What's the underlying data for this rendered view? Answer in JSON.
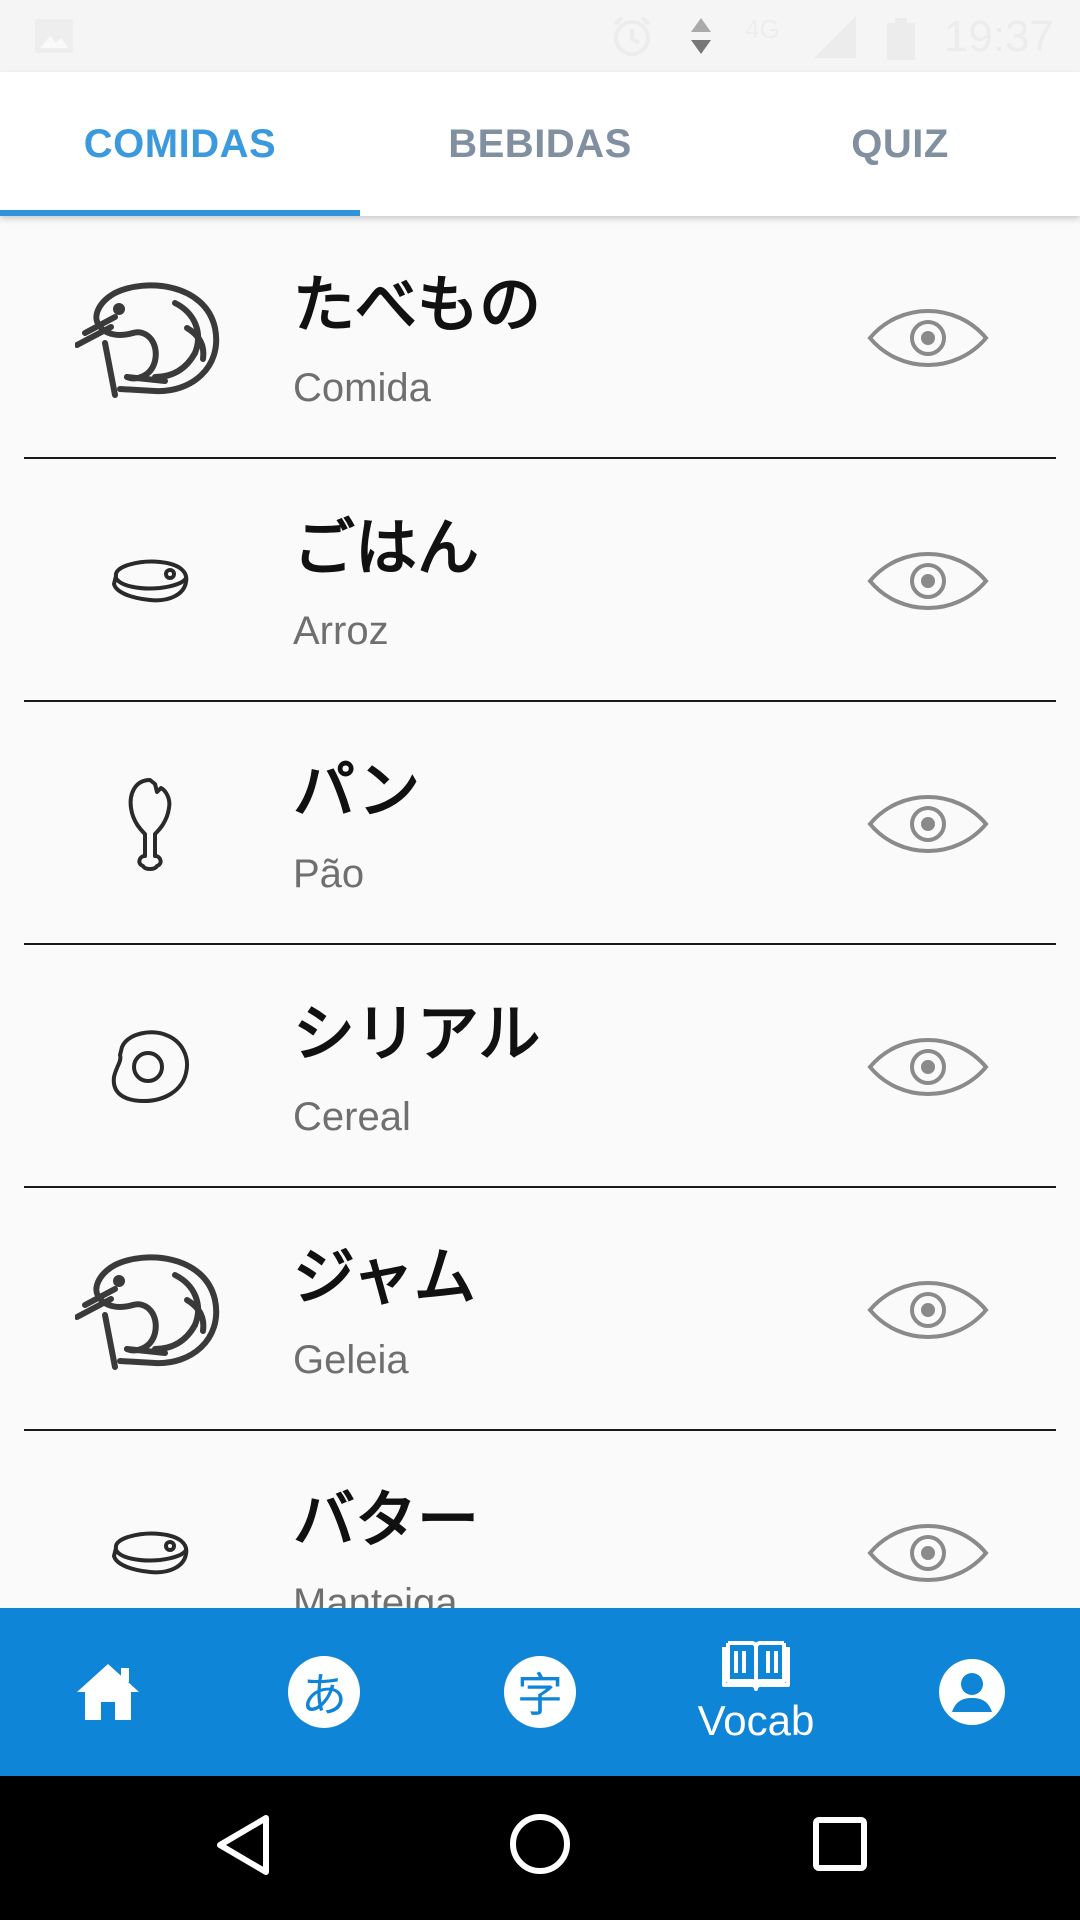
{
  "status_bar": {
    "time": "19:37",
    "network": "4G",
    "icons": [
      "image-icon",
      "alarm-icon",
      "data-arrows-icon",
      "wifi-icon",
      "signal-icon",
      "battery-icon"
    ]
  },
  "tabs": [
    {
      "label": "COMIDAS",
      "active": true
    },
    {
      "label": "BEBIDAS",
      "active": false
    },
    {
      "label": "QUIZ",
      "active": false
    }
  ],
  "items": [
    {
      "japanese": "たべもの",
      "portuguese": "Comida",
      "icon": "shrimp-icon"
    },
    {
      "japanese": "ごはん",
      "portuguese": "Arroz",
      "icon": "steak-icon"
    },
    {
      "japanese": "パン",
      "portuguese": "Pão",
      "icon": "chicken-leg-icon"
    },
    {
      "japanese": "シリアル",
      "portuguese": "Cereal",
      "icon": "fried-egg-icon"
    },
    {
      "japanese": "ジャム",
      "portuguese": "Geleia",
      "icon": "shrimp-icon"
    },
    {
      "japanese": "バター",
      "portuguese": "Manteiga",
      "icon": "steak-icon"
    }
  ],
  "bottom_nav": {
    "items": [
      {
        "icon": "home-icon"
      },
      {
        "icon": "hiragana-icon",
        "glyph": "あ"
      },
      {
        "icon": "kanji-icon",
        "glyph": "字"
      },
      {
        "icon": "book-icon",
        "label": "Vocab",
        "active": true
      },
      {
        "icon": "profile-icon"
      }
    ]
  },
  "colors": {
    "accent": "#3b9ade",
    "nav_bar": "#0f85d8",
    "tab_inactive": "#8190a1"
  }
}
